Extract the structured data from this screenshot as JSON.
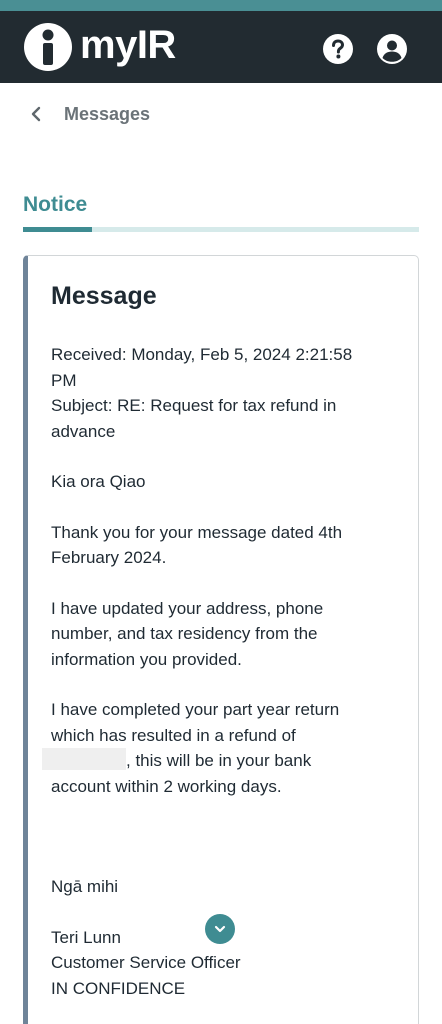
{
  "header": {
    "brand": "myIR",
    "icons": [
      "info-logo-icon",
      "help-icon",
      "account-icon"
    ],
    "colors": {
      "bar": "#222b31",
      "strip": "#4a8f94"
    }
  },
  "nav": {
    "back_label": "Messages"
  },
  "tab": {
    "title": "Notice",
    "accent": "#3f8c92"
  },
  "message": {
    "title": "Message",
    "received": [
      "Received: Monday, Feb 5, 2024 2:21:58",
      "PM"
    ],
    "subject": [
      "Subject: RE: Request for tax refund in",
      "advance"
    ],
    "greeting": "Kia ora Qiao",
    "p1": [
      "Thank you for your message dated 4th",
      "February 2024."
    ],
    "p2": [
      "I have updated your address, phone",
      "number, and tax residency from the",
      "information you provided."
    ],
    "p3": [
      "I have completed your part year return",
      "which has resulted in a refund of"
    ],
    "p3_after_redaction": ", this will be in your bank",
    "p3_last": "account within 2 working days.",
    "signoff": "Ngā mihi",
    "signature_name": "Teri Lunn",
    "signature_title": "Customer Service Officer",
    "confidential": "IN CONFIDENCE"
  }
}
